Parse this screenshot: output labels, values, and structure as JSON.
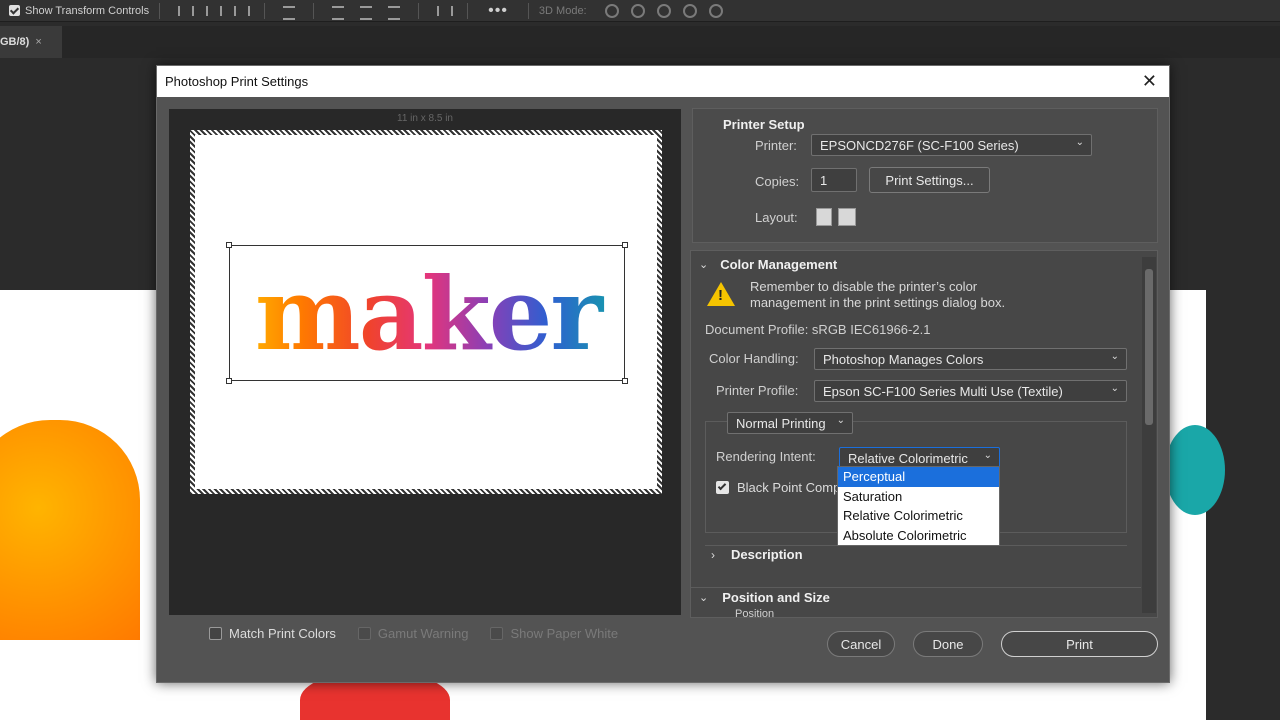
{
  "optbar": {
    "transform_label": "Show Transform Controls",
    "more_label": "•••",
    "mode3d_label": "3D Mode:"
  },
  "doc_tab": {
    "label": "GB/8)",
    "close": "×"
  },
  "dialog": {
    "title": "Photoshop Print Settings",
    "close": "✕",
    "paper_size": "11 in x 8.5 in",
    "preview_text": "maker",
    "bottom_checks": {
      "match": "Match Print Colors",
      "gamut": "Gamut Warning",
      "paper_white": "Show Paper White"
    },
    "printer_setup": {
      "header": "Printer Setup",
      "printer_label": "Printer:",
      "printer_value": "EPSONCD276F (SC-F100 Series)",
      "copies_label": "Copies:",
      "copies_value": "1",
      "print_settings_button": "Print Settings...",
      "layout_label": "Layout:"
    },
    "color_management": {
      "header": "Color Management",
      "warning_line1": "Remember to disable the printer’s color",
      "warning_line2": "management in the print settings dialog box.",
      "doc_profile": "Document Profile: sRGB IEC61966-2.1",
      "color_handling_label": "Color Handling:",
      "color_handling_value": "Photoshop Manages Colors",
      "printer_profile_label": "Printer Profile:",
      "printer_profile_value": "Epson SC-F100 Series Multi Use (Textile)",
      "normal_printing": "Normal Printing",
      "rendering_intent_label": "Rendering Intent:",
      "rendering_intent_value": "Relative Colorimetric",
      "black_point_label": "Black Point Comp",
      "intent_options": [
        "Perceptual",
        "Saturation",
        "Relative Colorimetric",
        "Absolute Colorimetric"
      ],
      "highlighted_option": "Perceptual"
    },
    "description": {
      "header": "Description"
    },
    "position_size": {
      "header": "Position and Size",
      "sub": "Position"
    },
    "buttons": {
      "cancel": "Cancel",
      "done": "Done",
      "print": "Print"
    }
  }
}
